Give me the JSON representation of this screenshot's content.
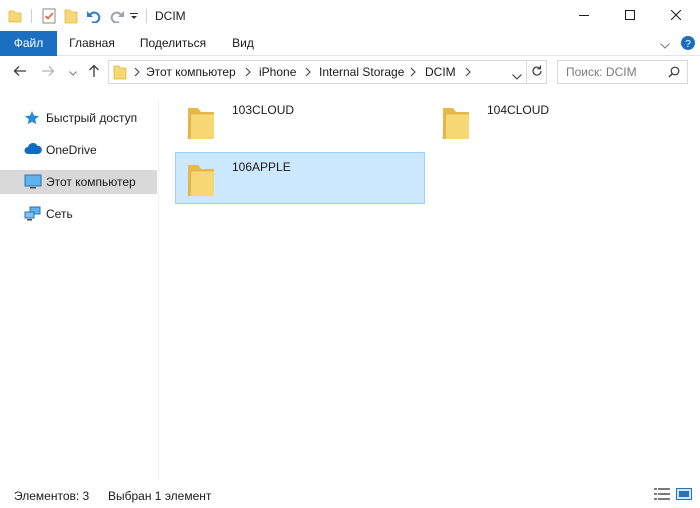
{
  "window": {
    "title": "DCIM",
    "minimize_icon": "minimize-icon",
    "maximize_icon": "maximize-icon",
    "close_icon": "close-icon"
  },
  "quick_access_toolbar": {
    "icons": [
      "folder-icon",
      "properties-check-icon",
      "new-folder-icon",
      "undo-icon",
      "redo-icon",
      "customize-chevron-icon"
    ]
  },
  "ribbon": {
    "tabs": [
      {
        "label": "Файл"
      },
      {
        "label": "Главная"
      },
      {
        "label": "Поделиться"
      },
      {
        "label": "Вид"
      }
    ]
  },
  "address_bar": {
    "breadcrumbs": [
      "Этот компьютер",
      "iPhone",
      "Internal Storage",
      "DCIM"
    ]
  },
  "search": {
    "placeholder": "Поиск: DCIM"
  },
  "navigation_pane": {
    "items": [
      {
        "label": "Быстрый доступ",
        "icon": "star-icon"
      },
      {
        "label": "OneDrive",
        "icon": "cloud-icon"
      },
      {
        "label": "Этот компьютер",
        "icon": "computer-icon",
        "selected": true
      },
      {
        "label": "Сеть",
        "icon": "network-icon"
      }
    ]
  },
  "content": {
    "items": [
      {
        "name": "103CLOUD",
        "selected": false
      },
      {
        "name": "104CLOUD",
        "selected": false
      },
      {
        "name": "106APPLE",
        "selected": true
      }
    ]
  },
  "status_bar": {
    "item_count": "Элементов: 3",
    "selection": "Выбран 1 элемент"
  },
  "colors": {
    "file_tab": "#1a6fc1",
    "selection_fill": "#cce8ff",
    "selection_border": "#99d1ff",
    "folder_yellow": "#f8d775"
  }
}
